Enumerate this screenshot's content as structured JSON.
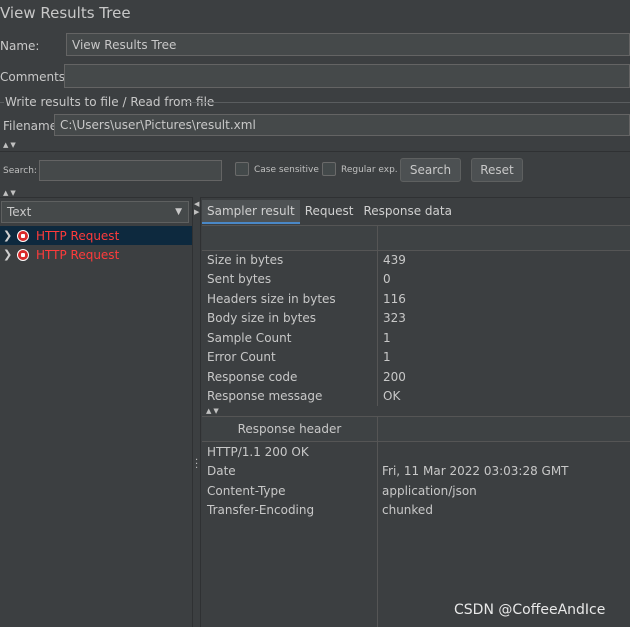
{
  "title": "View Results Tree",
  "name": {
    "label": "Name:",
    "value": "View Results Tree"
  },
  "comments": {
    "label": "Comments:",
    "value": ""
  },
  "write_group": {
    "label": "Write results to file / Read from file"
  },
  "filename": {
    "label": "Filename",
    "value": "C:\\Users\\user\\Pictures\\result.xml"
  },
  "search": {
    "label": "Search:",
    "value": "",
    "case_sensitive": "Case sensitive",
    "regular_exp": "Regular exp.",
    "search_button": "Search",
    "reset_button": "Reset"
  },
  "renderer": {
    "selected": "Text"
  },
  "tree": {
    "items": [
      {
        "label": "HTTP Request",
        "status_color": "#ff3b3b"
      },
      {
        "label": "HTTP Request",
        "status_color": "#ff3b3b"
      }
    ]
  },
  "tabs": [
    "Sampler result",
    "Request",
    "Response data"
  ],
  "sampler_rows": [
    {
      "key": "Size in bytes",
      "value": "439"
    },
    {
      "key": "Sent bytes",
      "value": "0"
    },
    {
      "key": "Headers size in bytes",
      "value": "116"
    },
    {
      "key": "Body size in bytes",
      "value": "323"
    },
    {
      "key": "Sample Count",
      "value": "1"
    },
    {
      "key": "Error Count",
      "value": "1"
    },
    {
      "key": "Response code",
      "value": "200"
    },
    {
      "key": "Response message",
      "value": "OK"
    }
  ],
  "response_header": {
    "title": "Response header",
    "rows": [
      {
        "key": "HTTP/1.1 200 OK",
        "value": ""
      },
      {
        "key": "Date",
        "value": "Fri, 11 Mar 2022 03:03:28 GMT"
      },
      {
        "key": "Content-Type",
        "value": "application/json"
      },
      {
        "key": "Transfer-Encoding",
        "value": "chunked"
      }
    ]
  },
  "watermark": "CSDN @CoffeeAndIce"
}
